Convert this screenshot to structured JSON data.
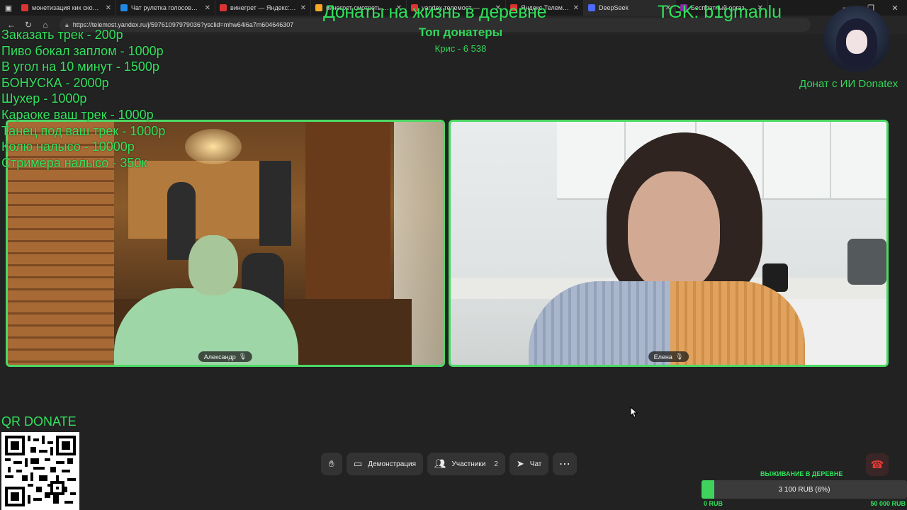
{
  "browser": {
    "tabs": [
      {
        "title": "монетизация кик сколько",
        "color": "#d33"
      },
      {
        "title": "Чат рулетка голосовая — ",
        "color": "#1e88e5"
      },
      {
        "title": "винегрет — Яндекс: нашл",
        "color": "#d33"
      },
      {
        "title": "винегрет смотреть и ска",
        "color": "#f9a825"
      },
      {
        "title": "yandex телемост — Яндек",
        "color": "#d33"
      },
      {
        "title": "Яндекс Телемост — ",
        "color": "#d33"
      },
      {
        "title": "DeepSeek",
        "color": "#4d6bfe"
      },
      {
        "title": "Бесплатный оргазм: сор",
        "color": "#8e24aa"
      }
    ],
    "url": "https://telemost.yandex.ru/j/59761097979036?ysclid=mhw64i6a7m604646307"
  },
  "overlay": {
    "title": "Донаты на жизнь в деревне",
    "tgk": "TGK: b1gmanlu",
    "top_donors_title": "Топ донатеры",
    "top_donor": "Крис - 6 538",
    "price_list": [
      "Заказать трек - 200р",
      "Пиво бокал заплом - 1000р",
      "В угол на 10 минут - 1500р",
      "БОНУСКА - 2000р",
      "Шухер - 1000р",
      "Караоке ваш трек - 1000р",
      "Танец под ваш трек - 1000р",
      "Колю налысо - 10000р",
      "Стримера налысо - 350к"
    ],
    "donate_ai": "Донат с ИИ Donatex",
    "qr_title": "QR DONATE"
  },
  "participants": {
    "left_name": "Александр",
    "right_name": "Елена"
  },
  "controls": {
    "demo_label": "Демонстрация",
    "participants_label": "Участники",
    "participants_count": "2",
    "chat_label": "Чат"
  },
  "goal": {
    "title": "ВЫЖИВАНИЕ В ДЕРЕВНЕ",
    "progress_text": "3 100 RUB (6%)",
    "progress_fraction": 0.062,
    "min_label": "0 RUB",
    "max_label": "50 000 RUB",
    "color": "#3fd35e"
  },
  "colors": {
    "overlay_green": "#2ee05a",
    "speaker_border": "#4cd964",
    "hangup_red": "#e53935"
  }
}
